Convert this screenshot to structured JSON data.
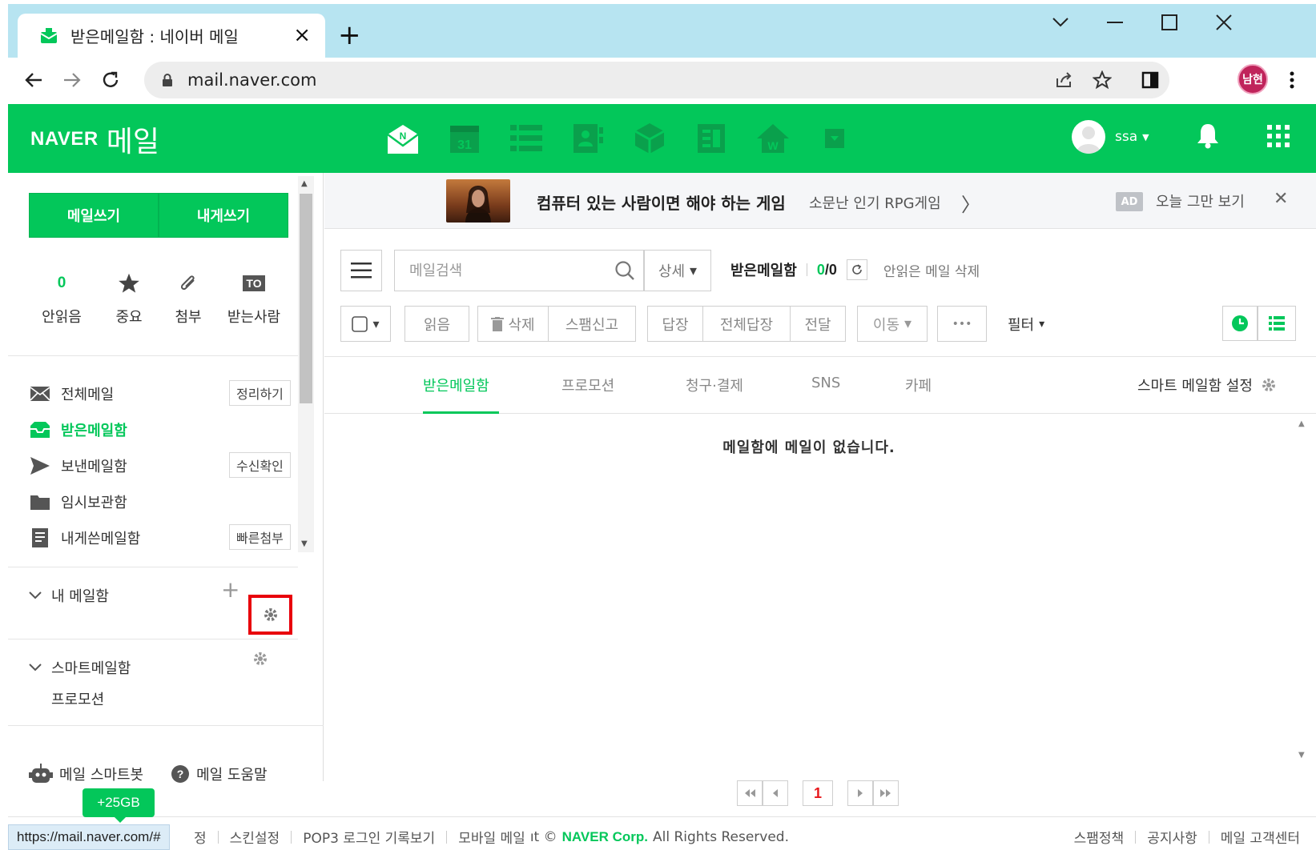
{
  "browser": {
    "tab_title": "받은메일함 : 네이버 메일",
    "tab_close": "×",
    "new_tab": "+",
    "url": "mail.naver.com",
    "profile_label": "남현",
    "status_url": "https://mail.naver.com/#"
  },
  "header": {
    "logo_naver": "NAVER",
    "logo_mail": "메일",
    "user_name": "ssa",
    "caret": "▼"
  },
  "sidebar": {
    "write_label": "메일쓰기",
    "self_write_label": "내게쓰기",
    "quick": [
      {
        "count": "0",
        "label": "안읽음"
      },
      {
        "label": "중요"
      },
      {
        "label": "첨부"
      },
      {
        "badge": "TO",
        "label": "받는사람"
      }
    ],
    "folders": [
      {
        "label": "전체메일",
        "action": "정리하기"
      },
      {
        "label": "받은메일함"
      },
      {
        "label": "보낸메일함",
        "action": "수신확인"
      },
      {
        "label": "임시보관함"
      },
      {
        "label": "내게쓴메일함",
        "action": "빠른첨부"
      }
    ],
    "my_mailbox": "내 메일함",
    "add_symbol": "+",
    "smart_mailbox": "스마트메일함",
    "promotion": "프로모션",
    "smart_bot": "메일 스마트봇",
    "help": "메일 도움말",
    "storage_tip": "+25GB"
  },
  "ad": {
    "title": "컴퓨터 있는 사람이면 해야 하는 게임",
    "subtitle": "소문난 인기 RPG게임",
    "arrow": "〉",
    "badge": "AD",
    "hide_today": "오늘 그만 보기",
    "close": "✕"
  },
  "toolbar": {
    "search_placeholder": "메일검색",
    "detail": "상세",
    "caret": "▾",
    "folder_name": "받은메일함",
    "count_unread": "0",
    "count_sep": "/",
    "count_total": "0",
    "delete_unread": "안읽은 메일 삭제",
    "read": "읽음",
    "delete": "삭제",
    "spam": "스팸신고",
    "reply": "답장",
    "reply_all": "전체답장",
    "forward": "전달",
    "move": "이동",
    "more": "•••",
    "filter": "필터"
  },
  "tabs": [
    {
      "label": "받은메일함",
      "active": true
    },
    {
      "label": "프로모션"
    },
    {
      "label": "청구·결제"
    },
    {
      "label": "SNS"
    },
    {
      "label": "카페"
    }
  ],
  "smart_settings": "스마트 메일함 설정",
  "empty_message": "메일함에 메일이 없습니다.",
  "pager": {
    "current": "1"
  },
  "footer": {
    "left_fragment": "정",
    "skin": "스킨설정",
    "pop3": "POP3 로그인 기록보기",
    "mobile": "모바일 메일",
    "mobile_tail": "ıt ©",
    "corp": "NAVER Corp.",
    "rights": "All Rights Reserved.",
    "spam_policy": "스팸정책",
    "notice": "공지사항",
    "support": "메일 고객센터"
  },
  "colors": {
    "brand_green": "#03c75a",
    "chrome_blue": "#b7e4f1",
    "highlight_red": "#e8000b"
  }
}
